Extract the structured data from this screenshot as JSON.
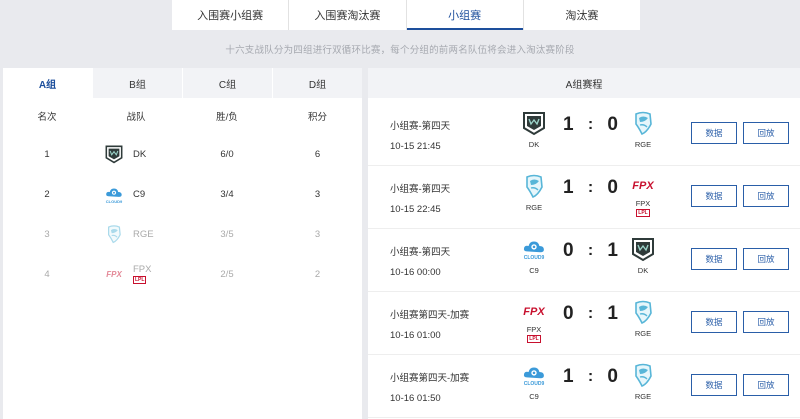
{
  "nav": {
    "tabs": [
      {
        "label": "入围赛小组赛",
        "active": false
      },
      {
        "label": "入围赛淘汰赛",
        "active": false
      },
      {
        "label": "小组赛",
        "active": true
      },
      {
        "label": "淘汰赛",
        "active": false
      }
    ]
  },
  "subtitle": "十六支战队分为四组进行双循环比赛，每个分组的前两名队伍将会进入淘汰赛阶段",
  "standings": {
    "groups": [
      "A组",
      "B组",
      "C组",
      "D组"
    ],
    "headers": {
      "rank": "名次",
      "team": "战队",
      "wl": "胜/负",
      "points": "积分"
    },
    "rows": [
      {
        "rank": "1",
        "team": "DK",
        "logo": "dk-logo",
        "wl": "6/0",
        "points": "6"
      },
      {
        "rank": "2",
        "team": "C9",
        "logo": "c9-logo",
        "wl": "3/4",
        "points": "3"
      },
      {
        "rank": "3",
        "team": "RGE",
        "logo": "rge-logo",
        "wl": "3/5",
        "points": "3"
      },
      {
        "rank": "4",
        "team": "FPX",
        "logo": "fpx-logo",
        "wl": "2/5",
        "points": "2"
      }
    ]
  },
  "schedule": {
    "title": "A组赛程",
    "data_label": "数据",
    "replay_label": "回放",
    "matches": [
      {
        "stage": "小组赛-第四天",
        "time": "10-15 21:45",
        "team_a": "DK",
        "score_a": "1",
        "colon": ":",
        "score_b": "0",
        "team_b": "RGE"
      },
      {
        "stage": "小组赛-第四天",
        "time": "10-15 22:45",
        "team_a": "RGE",
        "score_a": "1",
        "colon": ":",
        "score_b": "0",
        "team_b": "FPX"
      },
      {
        "stage": "小组赛-第四天",
        "time": "10-16 00:00",
        "team_a": "C9",
        "score_a": "0",
        "colon": ":",
        "score_b": "1",
        "team_b": "DK"
      },
      {
        "stage": "小组赛第四天-加赛",
        "time": "10-16 01:00",
        "team_a": "FPX",
        "score_a": "0",
        "colon": ":",
        "score_b": "1",
        "team_b": "RGE"
      },
      {
        "stage": "小组赛第四天-加赛",
        "time": "10-16 01:50",
        "team_a": "C9",
        "score_a": "1",
        "colon": ":",
        "score_b": "0",
        "team_b": "RGE"
      }
    ]
  },
  "logo_text": {
    "fpx": "FPX",
    "lpl": "LPL",
    "cloud9": "CLOUD9"
  },
  "colors": {
    "accent": "#1d4f9c",
    "fpx_red": "#c8102e",
    "c9_blue": "#3b9ad9",
    "rge_teal": "#58b6d8",
    "dk_dark": "#2f3b3a"
  }
}
